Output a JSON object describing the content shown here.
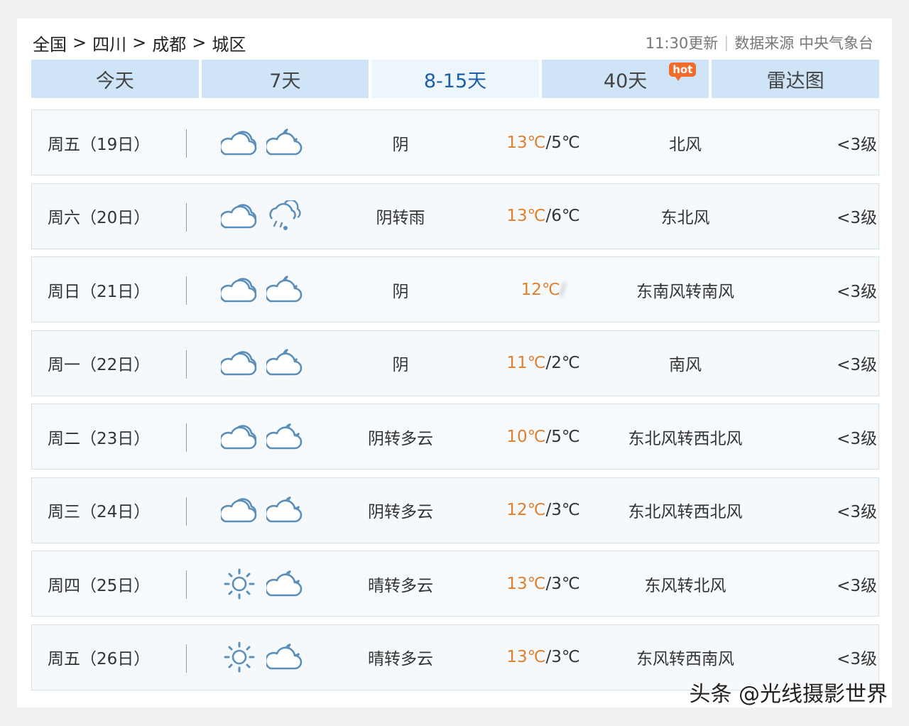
{
  "breadcrumb": {
    "country": "全国",
    "province": "四川",
    "city": "成都",
    "district": "城区",
    "sep": ">"
  },
  "meta": {
    "update": "11:30更新",
    "source": "数据来源 中央气象台"
  },
  "tabs": [
    {
      "label": "今天"
    },
    {
      "label": "7天"
    },
    {
      "label": "8-15天"
    },
    {
      "label": "40天",
      "badge": "hot"
    },
    {
      "label": "雷达图"
    }
  ],
  "rows": [
    {
      "day": "周五（19日）",
      "icons": [
        "cloudy-icon",
        "cloudy-night-icon"
      ],
      "desc": "阴",
      "hi": "13℃",
      "lo": "5℃",
      "wind": "北风",
      "level": "<3级"
    },
    {
      "day": "周六（20日）",
      "icons": [
        "cloudy-icon",
        "rain-icon"
      ],
      "desc": "阴转雨",
      "hi": "13℃",
      "lo": "6℃",
      "wind": "东北风",
      "level": "<3级"
    },
    {
      "day": "周日（21日）",
      "icons": [
        "cloudy-icon",
        "cloudy-night-icon"
      ],
      "desc": "阴",
      "hi": "12℃",
      "lo": "",
      "wind": "东南风转南风",
      "level": "<3级"
    },
    {
      "day": "周一（22日）",
      "icons": [
        "cloudy-icon",
        "cloudy-night-icon"
      ],
      "desc": "阴",
      "hi": "11℃",
      "lo": "2℃",
      "wind": "南风",
      "level": "<3级"
    },
    {
      "day": "周二（23日）",
      "icons": [
        "cloudy-icon",
        "partly-cloudy-night-icon"
      ],
      "desc": "阴转多云",
      "hi": "10℃",
      "lo": "5℃",
      "wind": "东北风转西北风",
      "level": "<3级"
    },
    {
      "day": "周三（24日）",
      "icons": [
        "cloudy-icon",
        "partly-cloudy-night-icon"
      ],
      "desc": "阴转多云",
      "hi": "12℃",
      "lo": "3℃",
      "wind": "东北风转西北风",
      "level": "<3级"
    },
    {
      "day": "周四（25日）",
      "icons": [
        "sunny-icon",
        "partly-cloudy-night-icon"
      ],
      "desc": "晴转多云",
      "hi": "13℃",
      "lo": "3℃",
      "wind": "东风转北风",
      "level": "<3级"
    },
    {
      "day": "周五（26日）",
      "icons": [
        "sunny-icon",
        "partly-cloudy-night-icon"
      ],
      "desc": "晴转多云",
      "hi": "13℃",
      "lo": "3℃",
      "wind": "东风转西南风",
      "level": "<3级"
    }
  ],
  "watermark": "头条 @光线摄影世界",
  "colors": {
    "high_temp": "#e0802e",
    "tab_bg": "#cfe5f7",
    "tab_active_text": "#1a5fa8",
    "hot_badge": "#f26b2b",
    "icon_stroke": "#5b8fb9"
  }
}
